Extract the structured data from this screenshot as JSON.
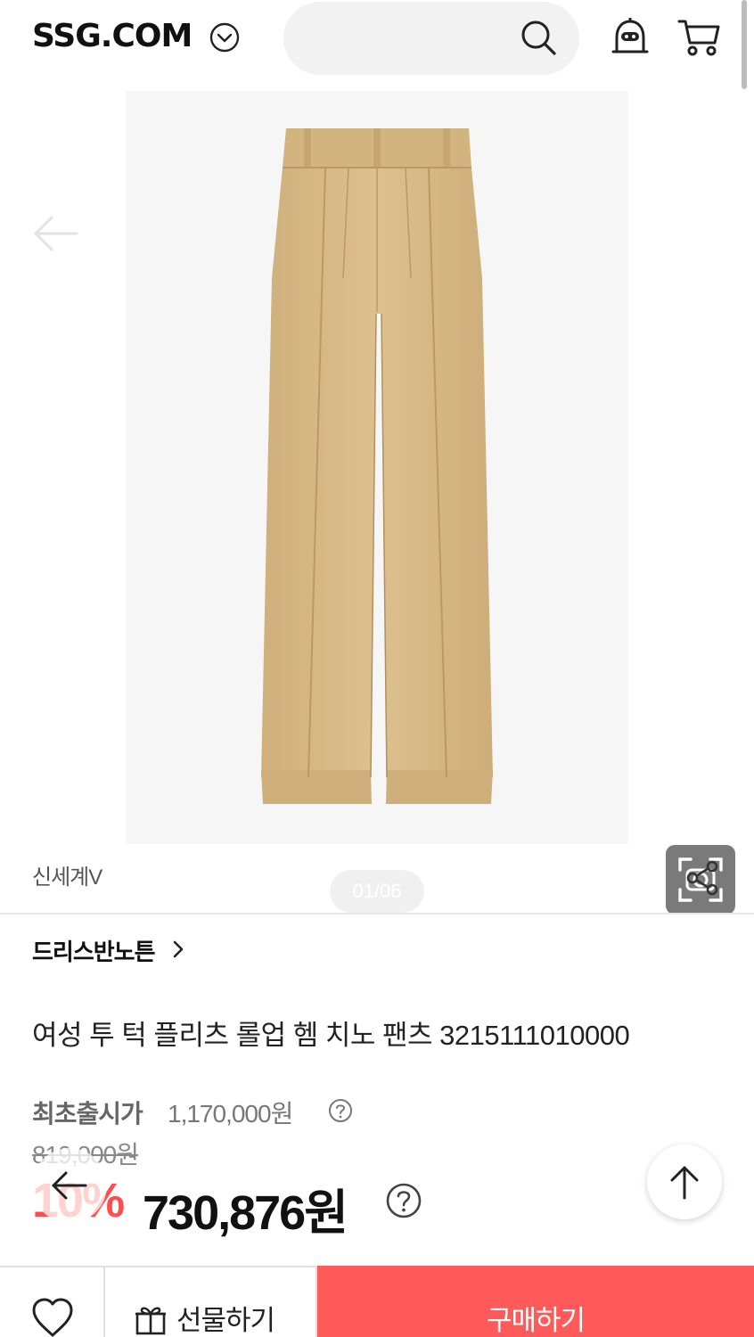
{
  "header": {
    "logo": "SSG.COM",
    "icons": {
      "logo_toggle": "chevron-down-circle-icon",
      "search": "search-icon",
      "bot": "talk-bot-icon",
      "cart": "cart-icon"
    }
  },
  "gallery": {
    "page_indicator": "01/06",
    "image_subject": "beige pleated chino pants",
    "icons": {
      "back": "arrow-left-icon",
      "lens": "camera-lens-icon"
    }
  },
  "seller": {
    "name": "신세계V",
    "share_icon": "share-icon"
  },
  "product": {
    "brand": "드리스반노튼",
    "title": "여성 투 턱 플리츠 롤업 헴 치노 팬츠 3215111010000",
    "original_label": "최초출시가",
    "original_price": "1,170,000원",
    "list_price": "819,000원",
    "discount_rate": "10%",
    "sale_price": "730,876원"
  },
  "bottom_bar": {
    "wish_icon": "heart-icon",
    "gift_label": "선물하기",
    "buy_label": "구매하기"
  },
  "colors": {
    "accent": "#ff5a5a",
    "discount": "#ff4c4c",
    "pants": "#d9bc8a"
  }
}
